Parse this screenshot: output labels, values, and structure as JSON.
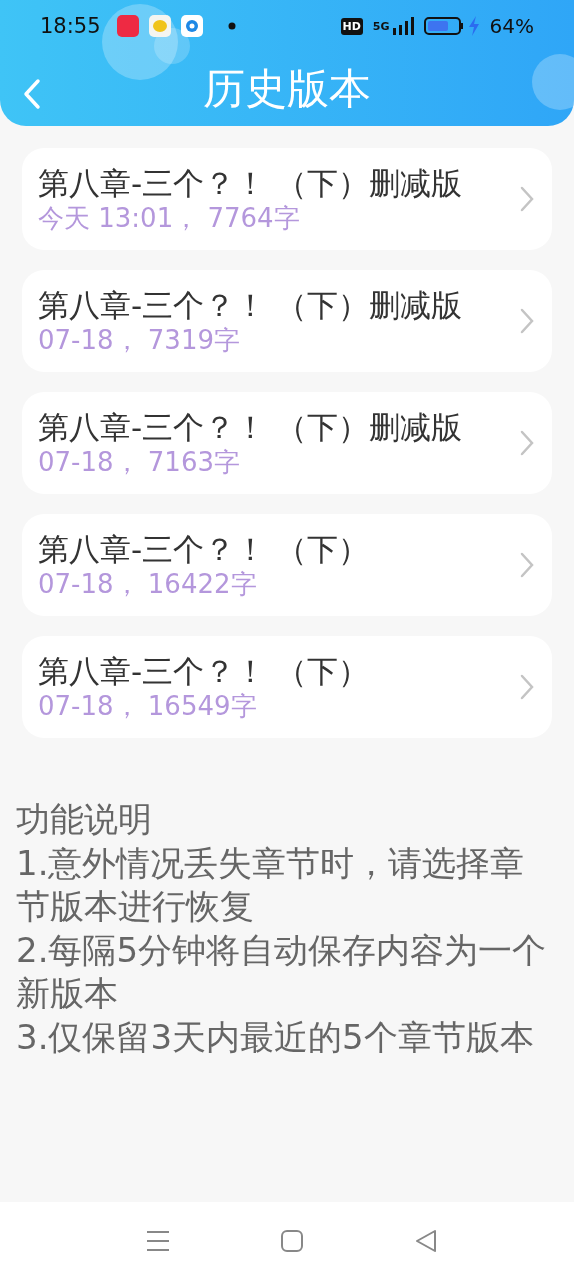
{
  "status_bar": {
    "time": "18:55",
    "hd": "HD",
    "network": "5G",
    "battery": "64%"
  },
  "header": {
    "title": "历史版本"
  },
  "versions": [
    {
      "title": "第八章-三个？！ （下）删减版",
      "meta": "今天 13:01，  7764字"
    },
    {
      "title": "第八章-三个？！ （下）删减版",
      "meta": "07-18，  7319字"
    },
    {
      "title": "第八章-三个？！ （下）删减版",
      "meta": "07-18，  7163字"
    },
    {
      "title": "第八章-三个？！ （下）",
      "meta": "07-18，  16422字"
    },
    {
      "title": "第八章-三个？！ （下）",
      "meta": "07-18，  16549字"
    }
  ],
  "notes": {
    "heading": "功能说明",
    "lines": [
      "1.意外情况丢失章节时，请选择章节版本进行恢复",
      "2.每隔5分钟将自动保存内容为一个新版本",
      "3.仅保留3天内最近的5个章节版本"
    ]
  }
}
